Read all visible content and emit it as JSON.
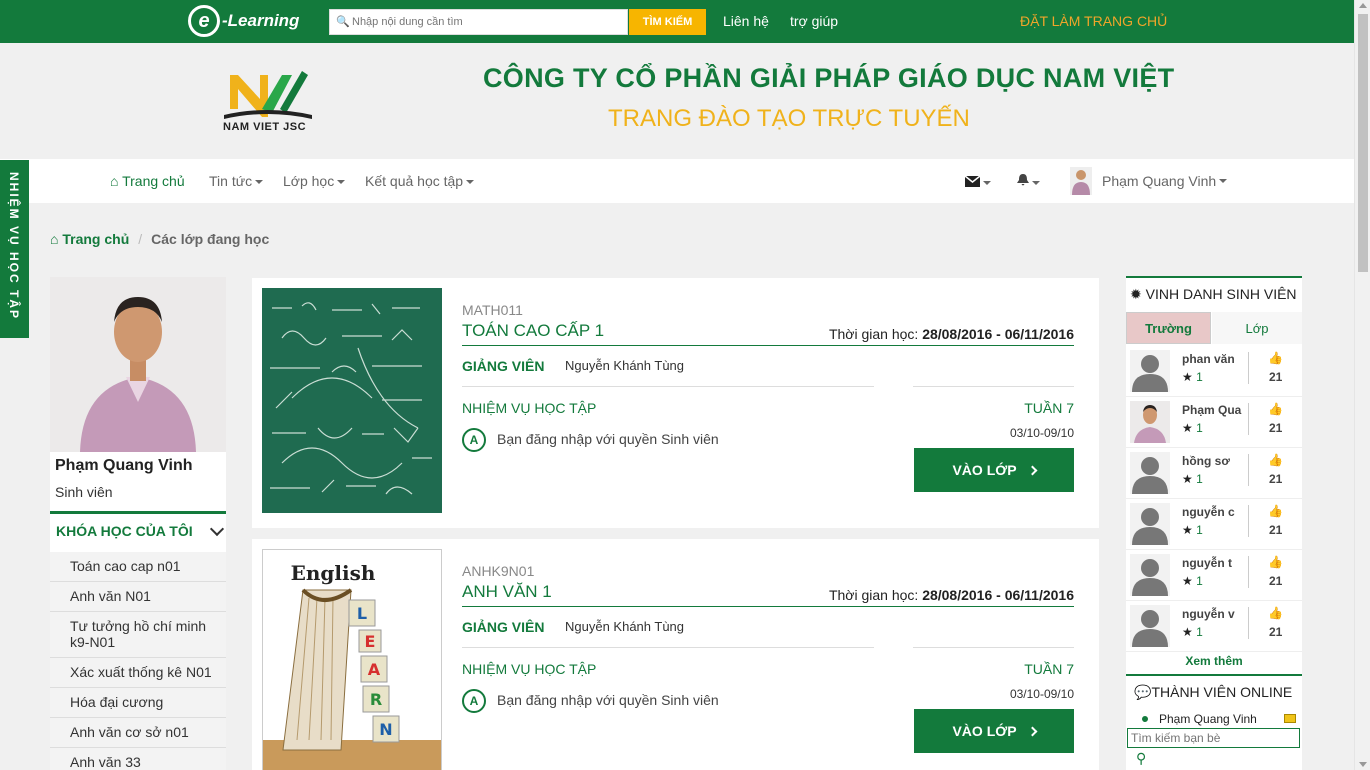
{
  "topbar": {
    "logo_letter": "e",
    "logo_text": "-Learning",
    "search_placeholder": "Nhập nội dung cần tìm",
    "search_button": "TÌM KIẾM",
    "links": [
      "Liên hệ",
      "trợ giúp"
    ],
    "set_home": "ĐẶT LÀM TRANG CHỦ"
  },
  "header": {
    "logo_caption": "NAM VIET JSC",
    "company": "CÔNG TY CỔ PHẦN GIẢI PHÁP GIÁO DỤC NAM VIỆT",
    "subtitle": "TRANG ĐÀO TẠO TRỰC TUYẾN"
  },
  "nav": {
    "home": "Trang chủ",
    "items": [
      "Tin tức",
      "Lớp học",
      "Kết quả học tập"
    ],
    "user": "Phạm Quang Vinh"
  },
  "side_tab": "NHIỆM VỤ HỌC TẬP",
  "breadcrumb": {
    "home": "Trang chủ",
    "current": "Các lớp đang học"
  },
  "profile": {
    "name": "Phạm Quang Vinh",
    "role": "Sinh viên",
    "my_courses_label": "KHÓA HỌC CỦA TÔI",
    "courses": [
      "Toán cao cap n01",
      "Anh văn N01",
      "Tư tưởng hồ chí minh k9-N01",
      "Xác xuất thống kê N01",
      "Hóa đại cương",
      "Anh văn cơ sở n01",
      "Anh văn 33"
    ]
  },
  "cards": [
    {
      "code": "MATH011",
      "title": "TOÁN CAO CẤP 1",
      "time_label": "Thời gian học:",
      "time_value": "28/08/2016 - 06/11/2016",
      "gv_label": "GIẢNG VIÊN",
      "gv_name": "Nguyễn Khánh Tùng",
      "task_label": "NHIỆM VỤ HỌC TẬP",
      "week": "TUẦN 7",
      "week_dates": "03/10-09/10",
      "badge": "A",
      "task": "Bạn đăng nhập với quyền Sinh viên",
      "button": "VÀO LỚP"
    },
    {
      "code": "ANHK9N01",
      "title": "ANH VĂN 1",
      "time_label": "Thời gian học:",
      "time_value": "28/08/2016 - 06/11/2016",
      "gv_label": "GIẢNG VIÊN",
      "gv_name": "Nguyễn Khánh Tùng",
      "task_label": "NHIỆM VỤ HỌC TẬP",
      "week": "TUẦN 7",
      "week_dates": "03/10-09/10",
      "badge": "A",
      "task": "Bạn đăng nhập với quyền Sinh viên",
      "button": "VÀO LỚP",
      "thumb_word": "English",
      "blocks": [
        "L",
        "E",
        "A",
        "R",
        "N"
      ]
    }
  ],
  "honor": {
    "title": "VINH DANH SINH VIÊN",
    "tabs": [
      "Trường",
      "Lớp"
    ],
    "students": [
      {
        "name": "phan văn",
        "stars": "1",
        "score": "21"
      },
      {
        "name": "Phạm Qua",
        "stars": "1",
        "score": "21"
      },
      {
        "name": "hồng sơ",
        "stars": "1",
        "score": "21"
      },
      {
        "name": "nguyễn c",
        "stars": "1",
        "score": "21"
      },
      {
        "name": "nguyễn t",
        "stars": "1",
        "score": "21"
      },
      {
        "name": "nguyễn v",
        "stars": "1",
        "score": "21"
      }
    ],
    "see_more": "Xem thêm"
  },
  "online": {
    "title": "THÀNH VIÊN ONLINE",
    "user": "Phạm Quang Vinh",
    "search_placeholder": "Tìm kiếm bạn bè"
  },
  "colors": {
    "primary": "#137a3c",
    "accent": "#f7b500",
    "subtitle": "#f0b21b"
  }
}
